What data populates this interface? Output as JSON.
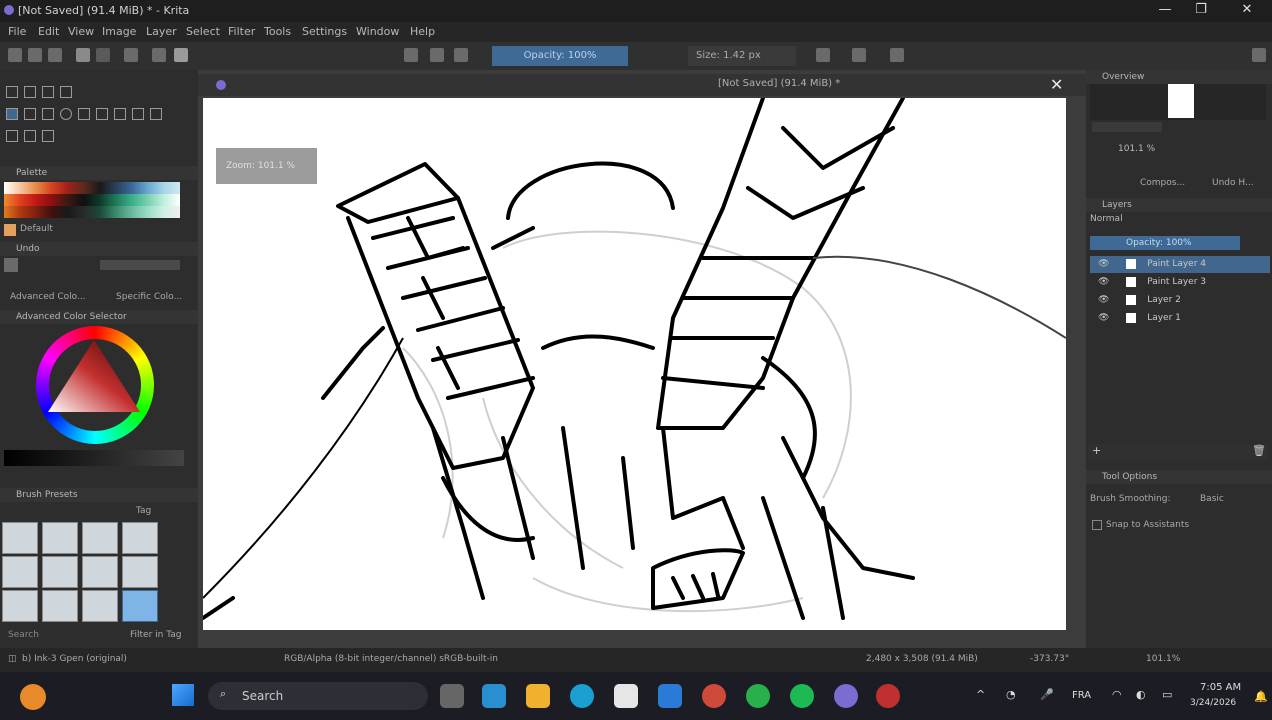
{
  "titlebar": {
    "title": "[Not Saved]  (91.4 MiB) * - Krita",
    "minimize": "—",
    "restore": "❐",
    "close": "✕"
  },
  "menu": [
    "File",
    "Edit",
    "View",
    "Image",
    "Layer",
    "Select",
    "Filter",
    "Tools",
    "Settings",
    "Window",
    "Help"
  ],
  "toolbar": {
    "opacity": "Opacity: 100%",
    "size": "Size: 1.42 px"
  },
  "left_dock": {
    "palette_title": "Palette",
    "palette_name": "Default",
    "history_title": "Undo",
    "tabs": [
      "Advanced Colo...",
      "Specific Colo..."
    ],
    "color_selector_title": "Advanced Color Selector",
    "brush_presets_title": "Brush Presets",
    "brush_tag": "Tag",
    "search_placeholder": "Search",
    "filter_in_tag": "Filter in Tag"
  },
  "document": {
    "tab_title": "[Not Saved]  (91.4 MiB) *",
    "zoom_tooltip": "Zoom: 101.1 %"
  },
  "right_dock": {
    "overview_title": "Overview",
    "zoom_value": "101.1 %",
    "tabs": [
      "Compos...",
      "Undo H..."
    ],
    "layers_title": "Layers",
    "blend_mode": "Normal",
    "opacity": "Opacity: 100%",
    "layers": [
      {
        "name": "Paint Layer 4",
        "selected": true
      },
      {
        "name": "Paint Layer 3",
        "selected": false
      },
      {
        "name": "Layer 2",
        "selected": false
      },
      {
        "name": "Layer 1",
        "selected": false
      }
    ],
    "tool_options_title": "Tool Options",
    "brush_smoothing_label": "Brush Smoothing:",
    "brush_smoothing_value": "Basic",
    "snap_label": "Snap to Assistants"
  },
  "statusbar": {
    "brush": "b) Ink-3 Gpen (original)",
    "color_info": "RGB/Alpha (8-bit integer/channel)  sRGB-built-in",
    "dimensions": "2,480 x 3,508 (91.4 MiB)",
    "rotation": "-373.73°",
    "zoom": "101.1%"
  },
  "taskbar": {
    "search_placeholder": "Search",
    "language": "FRA",
    "time": "7:05 AM",
    "date": "3/24/2026"
  },
  "colors": {
    "accent": "#3e6a95",
    "selected_layer": "#41678e"
  }
}
